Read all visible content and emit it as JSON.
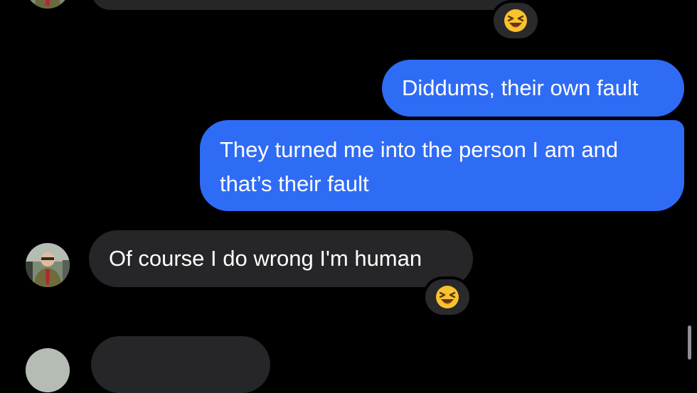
{
  "messages": [
    {
      "direction": "incoming",
      "text": "",
      "reaction": "laughing-emoji"
    },
    {
      "direction": "outgoing",
      "text": "Diddums, their own fault"
    },
    {
      "direction": "outgoing",
      "text": "They turned me into the person I am and that’s their fault"
    },
    {
      "direction": "incoming",
      "text": "Of course I do wrong I'm human",
      "reaction": "laughing-emoji"
    },
    {
      "direction": "incoming",
      "text": ""
    }
  ],
  "colors": {
    "background": "#000000",
    "incoming_bubble": "#262628",
    "outgoing_bubble": "#2f6cf5",
    "text": "#ffffff"
  }
}
